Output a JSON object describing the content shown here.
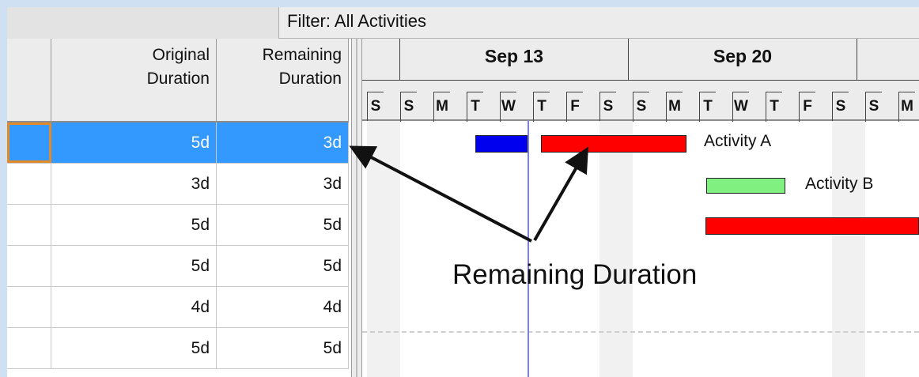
{
  "filter": {
    "label": "Filter: All Activities"
  },
  "columns": {
    "original_duration": {
      "line1": "Original",
      "line2": "Duration"
    },
    "remaining_duration": {
      "line1": "Remaining",
      "line2": "Duration"
    }
  },
  "rows": [
    {
      "original": "5d",
      "remaining": "3d",
      "selected": true
    },
    {
      "original": "3d",
      "remaining": "3d"
    },
    {
      "original": "5d",
      "remaining": "5d"
    },
    {
      "original": "5d",
      "remaining": "5d"
    },
    {
      "original": "4d",
      "remaining": "4d"
    },
    {
      "original": "5d",
      "remaining": "5d"
    }
  ],
  "timescale": {
    "weeks": [
      "Sep 13",
      "Sep 20"
    ],
    "days": [
      "S",
      "S",
      "M",
      "T",
      "W",
      "T",
      "F",
      "S",
      "S",
      "M",
      "T",
      "W",
      "T",
      "F",
      "S",
      "S",
      "M"
    ]
  },
  "activities": [
    {
      "label": "Activity A",
      "actual_color": "#0000ee",
      "remaining_color": "#ff0000"
    },
    {
      "label": "Activity B",
      "color": "#80f080"
    },
    {
      "color": "#ff0000"
    }
  ],
  "callout": {
    "text": "Remaining Duration"
  }
}
